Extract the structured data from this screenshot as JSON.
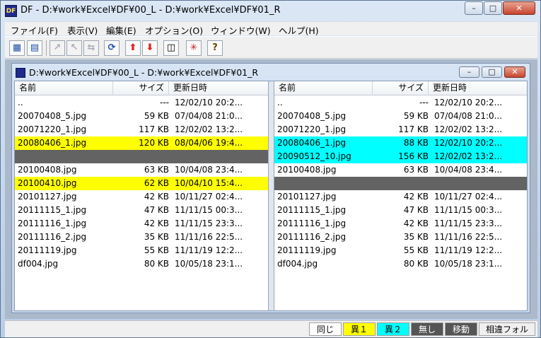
{
  "window": {
    "title": "DF - D:¥work¥Excel¥DF¥00_L  -  D:¥work¥Excel¥DF¥01_R",
    "icon_label": "DF",
    "minimize": "–",
    "maximize": "□",
    "close": "✕"
  },
  "menu": [
    "ファイル(F)",
    "表示(V)",
    "編集(E)",
    "オプション(O)",
    "ウィンドウ(W)",
    "ヘルプ(H)"
  ],
  "toolbar": [
    {
      "icon": "compare-icon",
      "glyph": "▦"
    },
    {
      "icon": "folder-compare-icon",
      "glyph": "▤"
    },
    {
      "icon": "copy-left-icon",
      "glyph": "↗"
    },
    {
      "icon": "copy-right-icon",
      "glyph": "↖"
    },
    {
      "icon": "copy-both-icon",
      "glyph": "⇆"
    },
    {
      "icon": "refresh-icon",
      "glyph": "⟳"
    },
    {
      "icon": "upload-icon",
      "glyph": "⬆"
    },
    {
      "icon": "download-icon",
      "glyph": "⬇"
    },
    {
      "icon": "window-icon",
      "glyph": "◫"
    },
    {
      "icon": "split-icon",
      "glyph": "✳"
    },
    {
      "icon": "help-icon",
      "glyph": "?"
    }
  ],
  "child_window": {
    "title": "D:¥work¥Excel¥DF¥00_L  -  D:¥work¥Excel¥DF¥01_R"
  },
  "columns": {
    "name": "名前",
    "size": "サイズ",
    "date": "更新日時"
  },
  "left_rows": [
    {
      "name": "..",
      "size": "---",
      "date": "12/02/10 20:2...",
      "status": "none"
    },
    {
      "name": "20070408_5.jpg",
      "size": "59 KB",
      "date": "07/04/08 21:0...",
      "status": "none"
    },
    {
      "name": "20071220_1.jpg",
      "size": "117 KB",
      "date": "12/02/02 13:2...",
      "status": "none"
    },
    {
      "name": "20080406_1.jpg",
      "size": "120 KB",
      "date": "08/04/06 19:4...",
      "status": "yellow"
    },
    {
      "name": "",
      "size": "",
      "date": "",
      "status": "gray"
    },
    {
      "name": "20100408.jpg",
      "size": "63 KB",
      "date": "10/04/08 23:4...",
      "status": "none"
    },
    {
      "name": "20100410.jpg",
      "size": "62 KB",
      "date": "10/04/10 15:4...",
      "status": "yellow"
    },
    {
      "name": "20101127.jpg",
      "size": "42 KB",
      "date": "10/11/27 02:4...",
      "status": "none"
    },
    {
      "name": "20111115_1.jpg",
      "size": "47 KB",
      "date": "11/11/15 00:3...",
      "status": "none"
    },
    {
      "name": "20111116_1.jpg",
      "size": "42 KB",
      "date": "11/11/15 23:3...",
      "status": "none"
    },
    {
      "name": "20111116_2.jpg",
      "size": "35 KB",
      "date": "11/11/16 22:5...",
      "status": "none"
    },
    {
      "name": "20111119.jpg",
      "size": "55 KB",
      "date": "11/11/19 12:2...",
      "status": "none"
    },
    {
      "name": "df004.jpg",
      "size": "80 KB",
      "date": "10/05/18 23:1...",
      "status": "none"
    }
  ],
  "right_rows": [
    {
      "name": "..",
      "size": "---",
      "date": "12/02/10 20:2...",
      "status": "none"
    },
    {
      "name": "20070408_5.jpg",
      "size": "59 KB",
      "date": "07/04/08 21:0...",
      "status": "none"
    },
    {
      "name": "20071220_1.jpg",
      "size": "117 KB",
      "date": "12/02/02 13:2...",
      "status": "none"
    },
    {
      "name": "20080406_1.jpg",
      "size": "88 KB",
      "date": "12/02/10 20:2...",
      "status": "cyan"
    },
    {
      "name": "20090512_10.jpg",
      "size": "156 KB",
      "date": "12/02/02 13:2...",
      "status": "cyan"
    },
    {
      "name": "20100408.jpg",
      "size": "63 KB",
      "date": "10/04/08 23:4...",
      "status": "none"
    },
    {
      "name": "",
      "size": "",
      "date": "",
      "status": "gray"
    },
    {
      "name": "20101127.jpg",
      "size": "42 KB",
      "date": "10/11/27 02:4...",
      "status": "none"
    },
    {
      "name": "20111115_1.jpg",
      "size": "47 KB",
      "date": "11/11/15 00:3...",
      "status": "none"
    },
    {
      "name": "20111116_1.jpg",
      "size": "42 KB",
      "date": "11/11/15 23:3...",
      "status": "none"
    },
    {
      "name": "20111116_2.jpg",
      "size": "35 KB",
      "date": "11/11/16 22:5...",
      "status": "none"
    },
    {
      "name": "20111119.jpg",
      "size": "55 KB",
      "date": "11/11/19 12:2...",
      "status": "none"
    },
    {
      "name": "df004.jpg",
      "size": "80 KB",
      "date": "10/05/18 23:1...",
      "status": "none"
    }
  ],
  "status_legend": [
    {
      "label": "同じ",
      "bg": "#ffffff",
      "fg": "#000000"
    },
    {
      "label": "異１",
      "bg": "#ffff00",
      "fg": "#000000"
    },
    {
      "label": "異２",
      "bg": "#00ffff",
      "fg": "#000000"
    },
    {
      "label": "無し",
      "bg": "#555555",
      "fg": "#ffffff"
    },
    {
      "label": "移動",
      "bg": "#555555",
      "fg": "#ffffff"
    },
    {
      "label": "相違フォル",
      "bg": "#f0f0f0",
      "fg": "#000000"
    }
  ]
}
